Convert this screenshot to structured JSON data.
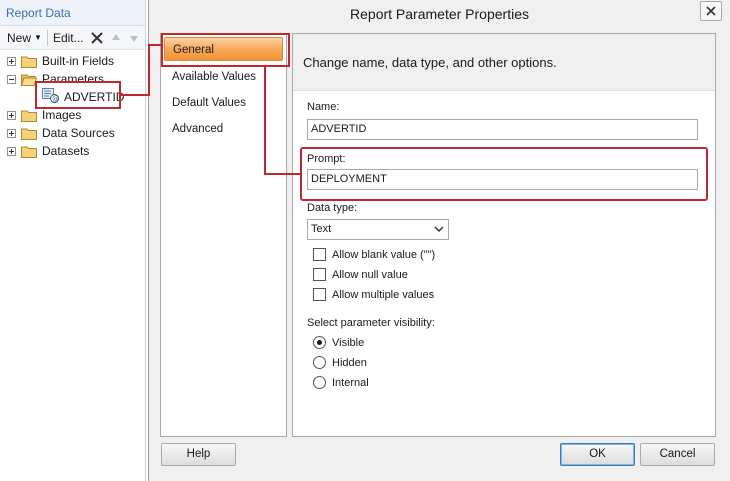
{
  "report_data": {
    "title": "Report Data",
    "toolbar": {
      "new_label": "New",
      "edit_label": "Edit..."
    },
    "tree": [
      {
        "label": "Built-in Fields",
        "expander": "plus"
      },
      {
        "label": "Parameters",
        "expander": "minus"
      },
      {
        "label": "Images",
        "expander": "plus"
      },
      {
        "label": "Data Sources",
        "expander": "plus"
      },
      {
        "label": "Datasets",
        "expander": "plus"
      }
    ],
    "parameter_item": "ADVERTID"
  },
  "dialog": {
    "title": "Report Parameter Properties",
    "nav": [
      {
        "label": "General",
        "active": true
      },
      {
        "label": "Available Values",
        "active": false
      },
      {
        "label": "Default Values",
        "active": false
      },
      {
        "label": "Advanced",
        "active": false
      }
    ],
    "header_text": "Change name, data type, and other options.",
    "name": {
      "label": "Name:",
      "value": "ADVERTID"
    },
    "prompt": {
      "label": "Prompt:",
      "value": "DEPLOYMENT"
    },
    "data_type": {
      "label": "Data type:",
      "value": "Text"
    },
    "options": [
      {
        "label": "Allow blank value (\"\")",
        "checked": false
      },
      {
        "label": "Allow null value",
        "checked": false
      },
      {
        "label": "Allow multiple values",
        "checked": false
      }
    ],
    "visibility": {
      "label": "Select parameter visibility:",
      "options": [
        {
          "label": "Visible",
          "checked": true
        },
        {
          "label": "Hidden",
          "checked": false
        },
        {
          "label": "Internal",
          "checked": false
        }
      ]
    },
    "buttons": {
      "help": "Help",
      "ok": "OK",
      "cancel": "Cancel"
    }
  },
  "colors": {
    "highlight": "#c0282d",
    "nav_active": "#f6a557",
    "pane_title": "#3c6fb3"
  }
}
